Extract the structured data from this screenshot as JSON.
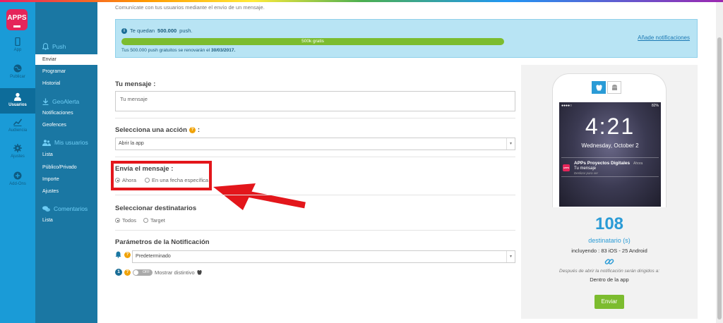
{
  "brand": {
    "logo_text": "APPS",
    "color": "#e5255a"
  },
  "rail": {
    "items": [
      {
        "label": "App",
        "icon": "phone-icon"
      },
      {
        "label": "Publicar",
        "icon": "globe-icon"
      },
      {
        "label": "Usuarios",
        "icon": "user-icon"
      },
      {
        "label": "Audiencia",
        "icon": "chart-icon"
      },
      {
        "label": "Ajustes",
        "icon": "gear-icon"
      },
      {
        "label": "Add-Ons",
        "icon": "plus-icon"
      }
    ]
  },
  "nav": {
    "push_section": "Push",
    "push_links": [
      "Enviar",
      "Programar",
      "Historial"
    ],
    "geo_section": "GeoAlerta",
    "geo_links": [
      "Notificaciones",
      "Geofences"
    ],
    "users_section": "Mis usuarios",
    "users_links": [
      "Lista",
      "Público/Privado",
      "Importe",
      "Ajustes"
    ],
    "comments_section": "Comentarios",
    "comments_links": [
      "Lista"
    ]
  },
  "main": {
    "subtitle": "Comunícate con tus usuarios mediante el envío de un mensaje.",
    "info": {
      "remaining_prefix": "Te quedan",
      "remaining_count": "500.000",
      "remaining_suffix": "push.",
      "progress_label": "500k gratis",
      "progress_fraction": 1.0,
      "renew_prefix": "Tus 500.000 push gratuitos se renovarán el",
      "renew_date": "30/03/2017.",
      "add_link": "Añade notificaciones"
    },
    "message": {
      "label": "Tu mensaje :",
      "placeholder": "Tu mensaje"
    },
    "action": {
      "label": "Selecciona una acción",
      "value": "Abrir la app"
    },
    "send_when": {
      "label": "Envía el mensaje :",
      "opt_now": "Ahora",
      "opt_date": "En una fecha específica"
    },
    "recipients": {
      "label": "Seleccionar destinatarios",
      "opt_all": "Todos",
      "opt_target": "Target"
    },
    "params": {
      "label": "Parámetros de la Notificación",
      "sound_value": "Predeterminado",
      "badge_toggle": "OFF",
      "badge_label": "Mostrar distintivo"
    }
  },
  "preview": {
    "status_left": "●●●●○",
    "status_right": "82%",
    "time": "4:21",
    "date": "Wednesday, October 2",
    "notif_app": "APPs Proyectos Digitales",
    "notif_when": "Ahora",
    "notif_msg": "Tu mensaje",
    "notif_sub": "Deslizar para ver",
    "count": "108",
    "count_label": "destinatario (s)",
    "including": "incluyendo : 83 iOS - 25 Android",
    "after_text": "Después de abrir la notificación serán dirigidos a:",
    "destination": "Dentro de la app",
    "send": "Enviar"
  }
}
